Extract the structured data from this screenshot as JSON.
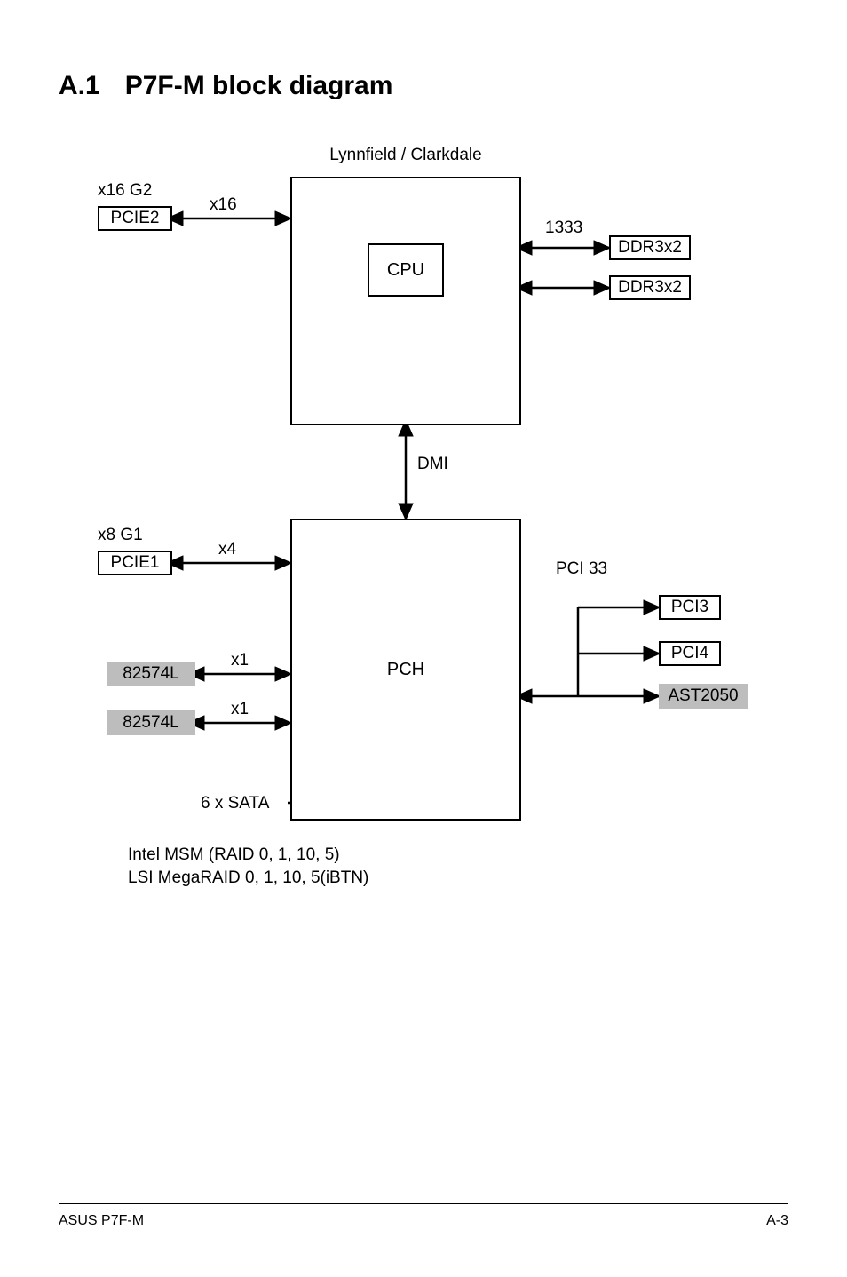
{
  "title": {
    "section_number": "A.1",
    "text": "P7F-M block diagram"
  },
  "diagram": {
    "header": "Lynnfield / Clarkdale",
    "cpu_label": "CPU",
    "pch_label": "PCH",
    "left_boxes": {
      "pcie2": "PCIE2",
      "pcie2_top": "x16 G2",
      "pcie2_link": "x16",
      "pcie1": "PCIE1",
      "pcie1_top": "x8 G1",
      "pcie1_link": "x4",
      "lan1": "82574L",
      "lan1_link": "x1",
      "lan2": "82574L",
      "lan2_link": "x1",
      "sata_label": "6 x SATA"
    },
    "right_boxes": {
      "ddr_speed": "1333",
      "ddr_a": "DDR3x2",
      "ddr_b": "DDR3x2",
      "pci33": "PCI 33",
      "pci3": "PCI3",
      "pci4": "PCI4",
      "ast2050": "AST2050"
    },
    "center_link": "DMI",
    "bottom_text_1": "Intel MSM (RAID 0, 1, 10, 5)",
    "bottom_text_2": "LSI MegaRAID 0, 1, 10, 5(iBTN)"
  },
  "footer": {
    "left": "ASUS P7F-M",
    "right": "A-3"
  },
  "chart_data": {
    "type": "block-diagram",
    "nodes": [
      {
        "id": "cpu",
        "label": "CPU",
        "family": "Lynnfield / Clarkdale"
      },
      {
        "id": "pch",
        "label": "PCH"
      },
      {
        "id": "pcie2",
        "label": "PCIE2",
        "slot_type": "x16 G2"
      },
      {
        "id": "pcie1",
        "label": "PCIE1",
        "slot_type": "x8 G1"
      },
      {
        "id": "ddr3_a",
        "label": "DDR3x2"
      },
      {
        "id": "ddr3_b",
        "label": "DDR3x2"
      },
      {
        "id": "lan1",
        "label": "82574L"
      },
      {
        "id": "lan2",
        "label": "82574L"
      },
      {
        "id": "pci3",
        "label": "PCI3"
      },
      {
        "id": "pci4",
        "label": "PCI4"
      },
      {
        "id": "ast2050",
        "label": "AST2050"
      },
      {
        "id": "sata",
        "label": "6 x SATA"
      }
    ],
    "edges": [
      {
        "from": "cpu",
        "to": "pcie2",
        "label": "x16",
        "dir": "bi"
      },
      {
        "from": "cpu",
        "to": "ddr3_a",
        "label": "1333",
        "dir": "bi"
      },
      {
        "from": "cpu",
        "to": "ddr3_b",
        "label": "",
        "dir": "bi"
      },
      {
        "from": "cpu",
        "to": "pch",
        "label": "DMI",
        "dir": "bi"
      },
      {
        "from": "pch",
        "to": "pcie1",
        "label": "x4",
        "dir": "bi"
      },
      {
        "from": "pch",
        "to": "lan1",
        "label": "x1",
        "dir": "bi"
      },
      {
        "from": "pch",
        "to": "lan2",
        "label": "x1",
        "dir": "bi"
      },
      {
        "from": "pch",
        "to": "pci3",
        "label": "PCI 33",
        "dir": "uni"
      },
      {
        "from": "pch",
        "to": "pci4",
        "label": "PCI 33",
        "dir": "uni"
      },
      {
        "from": "pch",
        "to": "ast2050",
        "label": "",
        "dir": "bi"
      },
      {
        "from": "pch",
        "to": "sata",
        "label": "",
        "dir": "none"
      }
    ],
    "raid_options": [
      "Intel MSM (RAID 0, 1, 10, 5)",
      "LSI MegaRAID 0, 1, 10, 5(iBTN)"
    ]
  }
}
